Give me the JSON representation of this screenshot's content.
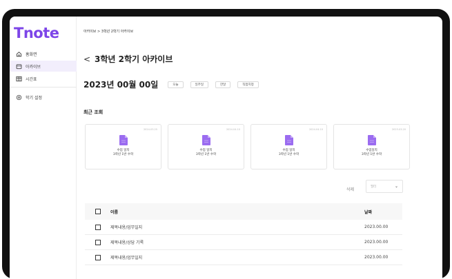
{
  "app": {
    "logo": "Tnote"
  },
  "sidebar": {
    "items": [
      {
        "label": "홈화면",
        "icon": "home-icon"
      },
      {
        "label": "아카이브",
        "icon": "archive-icon",
        "active": true
      },
      {
        "label": "시간표",
        "icon": "calendar-icon"
      }
    ],
    "settings": {
      "label": "학기 설정",
      "icon": "gear-icon"
    }
  },
  "header": {
    "breadcrumb": "아카이브 > 3학년 2학기 아카이브",
    "back_label": "<",
    "title": "3학년 2학기 아카이브"
  },
  "date_bar": {
    "date": "2023년 00월 00일",
    "chips": [
      "오늘",
      "일주일",
      "한달",
      "직접지정"
    ]
  },
  "recent": {
    "title": "최근 조회",
    "cards": [
      {
        "date": "2024.03.25",
        "line1": "수업 일지",
        "line2": "3학년 1반 수학"
      },
      {
        "date": "2024.04.10",
        "line1": "수업 일지",
        "line2": "3학년 1반 수학"
      },
      {
        "date": "2024.04.10",
        "line1": "수업 일지",
        "line2": "3학년 1반 수학"
      },
      {
        "date": "2023.03.20",
        "line1": "수업일지",
        "line2": "3학년 1반 수학"
      }
    ]
  },
  "toolbar": {
    "delete_label": "삭제",
    "filter_placeholder": "필터",
    "filter_chevron": "⌄"
  },
  "table": {
    "headers": {
      "name": "이름",
      "date": "날짜"
    },
    "rows": [
      {
        "name": "제목내용/업무일지",
        "date": "2023.00.00"
      },
      {
        "name": "제목내용/상담 기록",
        "date": "2023.00.00"
      },
      {
        "name": "제목내용/업무일지",
        "date": "2023.00.00"
      }
    ]
  },
  "colors": {
    "accent": "#7d45e8",
    "file_icon": "#9b6cf0",
    "active_bg": "#f2eefc"
  }
}
